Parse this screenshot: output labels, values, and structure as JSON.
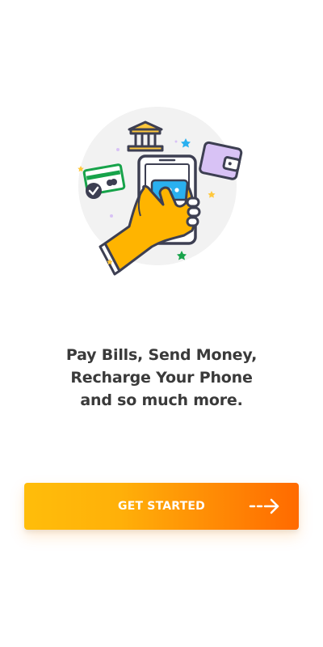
{
  "onboarding": {
    "illustration": {
      "icon": "mobile-payments-illustration",
      "colors": {
        "circle": "#f2f2f2",
        "outline": "#3d3f52",
        "hand": "#ffb400",
        "phone_screen": "#ffffff",
        "chat_bubble": "#2ab0f0",
        "card": "#17a34a",
        "wallet": "#d8c2f5",
        "bank": "#ffc83d"
      }
    },
    "tagline": {
      "line1": "Pay Bills, Send Money,",
      "line2": "Recharge Your Phone",
      "line3": "and so much more."
    },
    "cta": {
      "label": "GET STARTED",
      "icon": "arrow-right-icon",
      "gradient_start": "#ffbd0a",
      "gradient_end": "#ff6a00"
    }
  }
}
